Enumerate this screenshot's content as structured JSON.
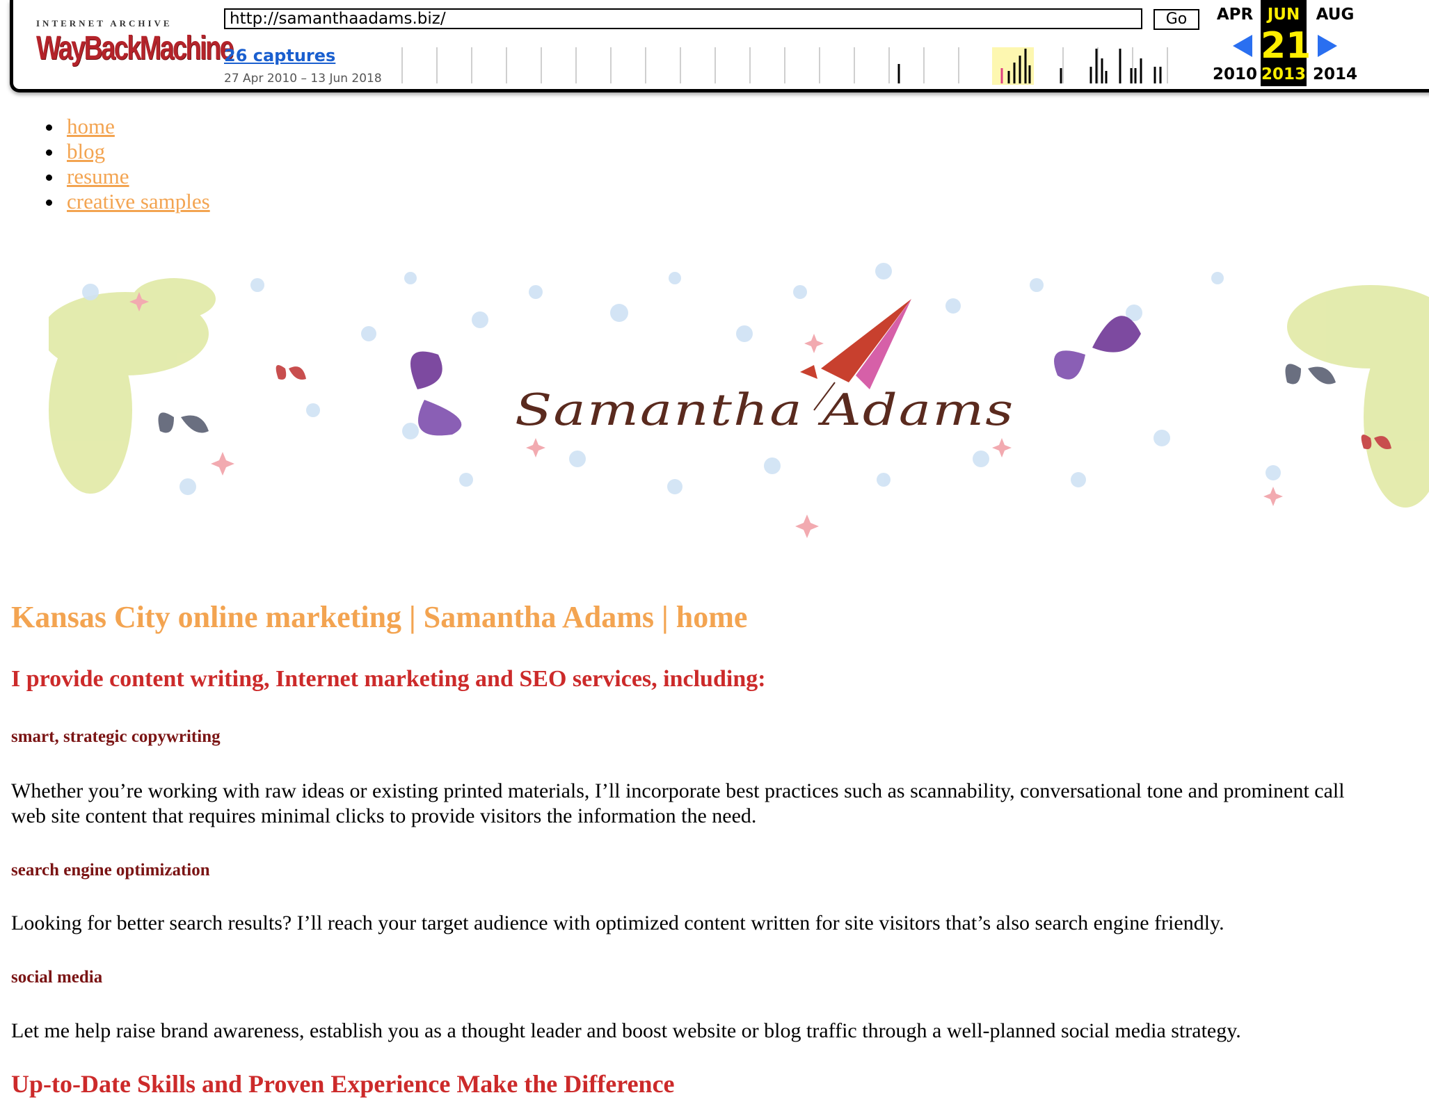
{
  "wayback": {
    "logo_top": "INTERNET ARCHIVE",
    "logo_main": "WayBackMachine",
    "url": "http://samanthaadams.biz/",
    "go_label": "Go",
    "captures_label": "26 captures",
    "date_range": "27 Apr 2010 – 13 Jun 2018",
    "prev_month": "APR",
    "cur_month": "JUN",
    "next_month": "AUG",
    "cur_day": "21",
    "prev_year": "2010",
    "cur_year": "2013",
    "next_year": "2014",
    "colors": {
      "logo": "#b4232a",
      "link": "#1a5fcf",
      "arrow": "#2a6ff0",
      "highlight": "#ffef00"
    }
  },
  "nav": {
    "items": [
      {
        "label": "home"
      },
      {
        "label": "blog"
      },
      {
        "label": "resume"
      },
      {
        "label": "creative samples"
      }
    ],
    "link_color": "#f3a451"
  },
  "banner": {
    "signature": "Samantha Adams"
  },
  "main": {
    "title": "Kansas City online marketing | Samantha Adams | home",
    "intro": "I provide content writing, Internet marketing and SEO services, including:",
    "services": [
      {
        "title": "smart, strategic copywriting",
        "line1": "Whether you’re working with raw ideas or existing printed materials, I’ll incorporate best practices such as scannability, conversational tone and prominent call",
        "line2": "web site content that requires minimal clicks to provide visitors the information the need."
      },
      {
        "title": "search engine optimization",
        "line1": "Looking for better search results? I’ll reach your target audience with optimized content written for site visitors that’s also search engine friendly."
      },
      {
        "title": "social media",
        "line1": "Let me help raise brand awareness, establish you as a thought leader and boost website or blog traffic through a well-planned social media strategy."
      }
    ],
    "bottom_heading": "Up-to-Date Skills and Proven Experience Make the Difference"
  }
}
